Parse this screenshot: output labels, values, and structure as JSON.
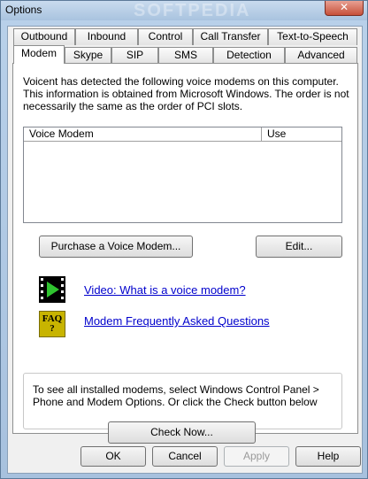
{
  "window": {
    "title": "Options",
    "watermark": "SOFTPEDIA",
    "close_glyph": "✕"
  },
  "tabs": {
    "row_back": [
      "Outbound",
      "Inbound",
      "Control",
      "Call Transfer",
      "Text-to-Speech"
    ],
    "row_front": [
      "Modem",
      "Skype",
      "SIP",
      "SMS",
      "Detection",
      "Advanced"
    ],
    "active": "Modem"
  },
  "modem_tab": {
    "description": "Voicent has detected the following voice modems on this computer. This information is obtained from Microsoft Windows. The order is not necessarily the same as the order of PCI slots.",
    "list_columns": [
      "Voice Modem",
      "Use"
    ],
    "list_rows": [],
    "purchase_label": "Purchase a Voice Modem...",
    "edit_label": "Edit...",
    "video_link": "Video: What is a voice modem?",
    "faq_link": "Modem Frequently Asked Questions",
    "faq_icon_text": "FAQ\n?",
    "info_text": "To see all installed modems, select Windows Control Panel > Phone and Modem Options. Or click the Check button below",
    "check_label": "Check Now..."
  },
  "footer": {
    "ok": "OK",
    "cancel": "Cancel",
    "apply": "Apply",
    "help": "Help"
  },
  "colors": {
    "link": "#0000cc",
    "faq_icon_bg": "#c8b400",
    "video_icon_bg": "#000000",
    "video_play": "#2fc42f"
  },
  "icons": {
    "video": "film-play-icon",
    "faq": "faq-icon"
  }
}
